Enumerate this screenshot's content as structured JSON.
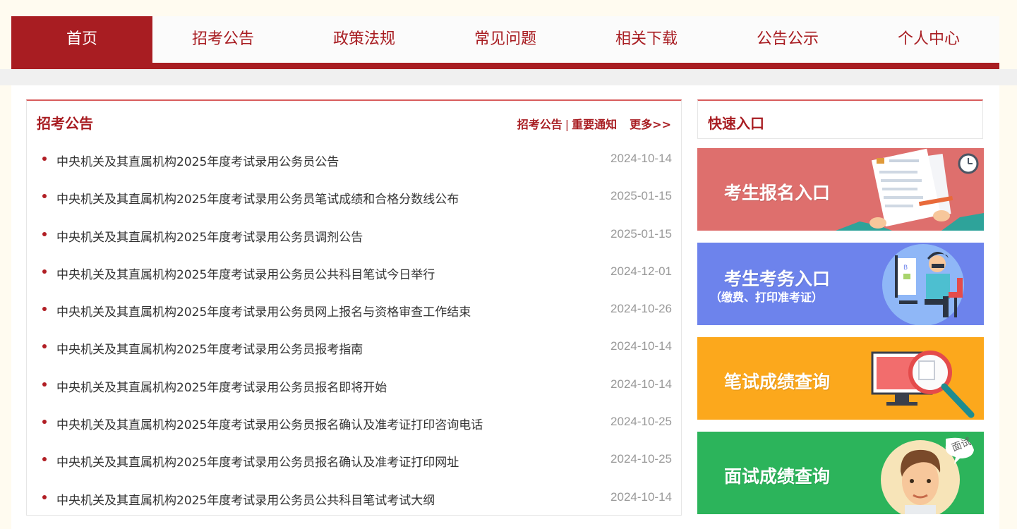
{
  "nav": {
    "items": [
      "首页",
      "招考公告",
      "政策法规",
      "常见问题",
      "相关下载",
      "公告公示",
      "个人中心"
    ],
    "active_index": 0
  },
  "announcements": {
    "title": "招考公告",
    "links": [
      "招考公告",
      "重要通知"
    ],
    "separator": "|",
    "more": "更多>>",
    "items": [
      {
        "title": "中央机关及其直属机构2025年度考试录用公务员公告",
        "date": "2024-10-14"
      },
      {
        "title": "中央机关及其直属机构2025年度考试录用公务员笔试成绩和合格分数线公布",
        "date": "2025-01-15"
      },
      {
        "title": "中央机关及其直属机构2025年度考试录用公务员调剂公告",
        "date": "2025-01-15"
      },
      {
        "title": "中央机关及其直属机构2025年度考试录用公务员公共科目笔试今日举行",
        "date": "2024-12-01"
      },
      {
        "title": "中央机关及其直属机构2025年度考试录用公务员网上报名与资格审查工作结束",
        "date": "2024-10-26"
      },
      {
        "title": "中央机关及其直属机构2025年度考试录用公务员报考指南",
        "date": "2024-10-14"
      },
      {
        "title": "中央机关及其直属机构2025年度考试录用公务员报名即将开始",
        "date": "2024-10-14"
      },
      {
        "title": "中央机关及其直属机构2025年度考试录用公务员报名确认及准考证打印咨询电话",
        "date": "2024-10-25"
      },
      {
        "title": "中央机关及其直属机构2025年度考试录用公务员报名确认及准考证打印网址",
        "date": "2024-10-25"
      },
      {
        "title": "中央机关及其直属机构2025年度考试录用公务员公共科目笔试考试大纲",
        "date": "2024-10-14"
      }
    ]
  },
  "quick": {
    "title": "快速入口",
    "tiles": [
      {
        "label": "考生报名入口",
        "sub": "",
        "color": "#de6f6d",
        "icon": "application-form-icon"
      },
      {
        "label": "考生考务入口",
        "sub": "（缴费、打印准考证）",
        "color": "#6d83ec",
        "icon": "computer-user-icon"
      },
      {
        "label": "笔试成绩查询",
        "sub": "",
        "color": "#fca81c",
        "icon": "magnifier-monitor-icon"
      },
      {
        "label": "面试成绩查询",
        "sub": "",
        "color": "#2cb45b",
        "icon": "interview-avatar-icon",
        "badge": "面试"
      }
    ]
  },
  "colors": {
    "brand": "#a81d22",
    "accent_border": "#d85c5c",
    "page_bg": "#fffbf0"
  }
}
